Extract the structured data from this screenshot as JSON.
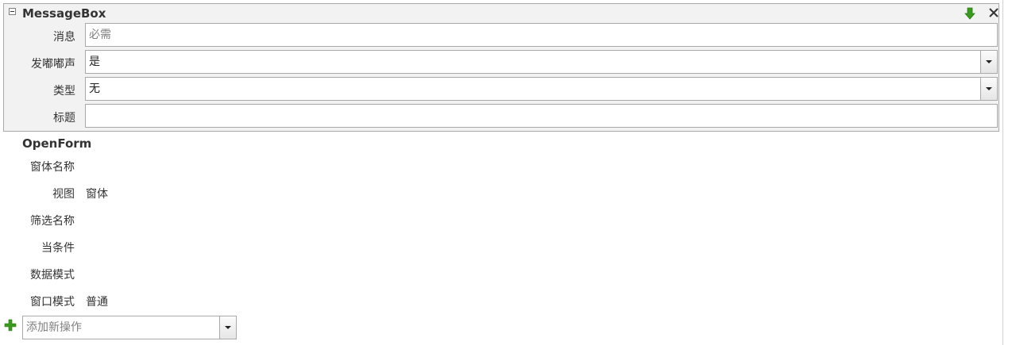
{
  "messagebox": {
    "title": "MessageBox",
    "fields": {
      "message": {
        "label": "消息",
        "placeholder": "必需"
      },
      "beep": {
        "label": "发嘟嘟声",
        "value": "是"
      },
      "type": {
        "label": "类型",
        "value": "无"
      },
      "title_field": {
        "label": "标题",
        "value": ""
      }
    }
  },
  "openform": {
    "title": "OpenForm",
    "fields": {
      "form_name": {
        "label": "窗体名称",
        "value": ""
      },
      "view": {
        "label": "视图",
        "value": "窗体"
      },
      "filter_name": {
        "label": "筛选名称",
        "value": ""
      },
      "where_condition": {
        "label": "当条件",
        "value": ""
      },
      "data_mode": {
        "label": "数据模式",
        "value": ""
      },
      "window_mode": {
        "label": "窗口模式",
        "value": "普通"
      }
    }
  },
  "add_action": {
    "placeholder": "添加新操作"
  },
  "icons": {
    "collapse": "collapse-minus-icon",
    "move_down": "green-arrow-down-icon",
    "close": "close-x-icon",
    "add": "green-plus-icon"
  },
  "colors": {
    "accent_green": "#3a9a1e",
    "panel_bg": "#f2f2f2",
    "border": "#a9a9a9"
  }
}
